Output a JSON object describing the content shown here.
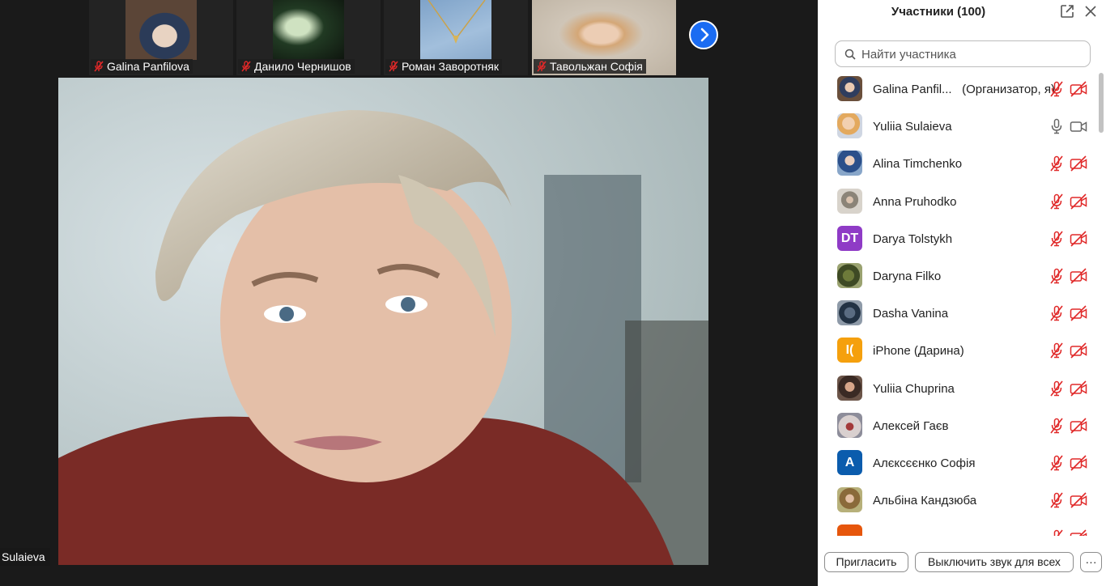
{
  "thumbnails": [
    {
      "name": "Galina Panfilova",
      "muted": true
    },
    {
      "name": "Данило Чернишов",
      "muted": true
    },
    {
      "name": "Роман Заворотняк",
      "muted": true
    },
    {
      "name": "Тавольжан Софія",
      "muted": true
    }
  ],
  "speaker": {
    "name_tag": "Sulaieva"
  },
  "panel": {
    "title": "Участники (100)",
    "search_placeholder": "Найти участника",
    "participants": [
      {
        "name": "Galina Panfil...",
        "role": "(Организатор, я)",
        "avatar": "photo",
        "mic": "muted",
        "cam": "off"
      },
      {
        "name": "Yuliia Sulaieva",
        "role": "",
        "avatar": "photo",
        "mic": "on",
        "cam": "on"
      },
      {
        "name": "Alina Timchenko",
        "role": "",
        "avatar": "photo",
        "mic": "muted",
        "cam": "off"
      },
      {
        "name": "Anna Pruhodko",
        "role": "",
        "avatar": "photo",
        "mic": "muted",
        "cam": "off"
      },
      {
        "name": "Darya Tolstykh",
        "role": "",
        "avatar": "initials",
        "initials": "DT",
        "avatar_color": "#8f3bc6",
        "mic": "muted",
        "cam": "off"
      },
      {
        "name": "Daryna Filko",
        "role": "",
        "avatar": "photo",
        "mic": "muted",
        "cam": "off"
      },
      {
        "name": "Dasha Vanina",
        "role": "",
        "avatar": "photo",
        "mic": "muted",
        "cam": "off"
      },
      {
        "name": "iPhone (Дарина)",
        "role": "",
        "avatar": "initials",
        "initials": "I(",
        "avatar_color": "#f5a00d",
        "mic": "muted",
        "cam": "off"
      },
      {
        "name": "Yuliia Chuprina",
        "role": "",
        "avatar": "photo",
        "mic": "muted",
        "cam": "off"
      },
      {
        "name": "Алексей Гаєв",
        "role": "",
        "avatar": "photo",
        "mic": "muted",
        "cam": "off"
      },
      {
        "name": "Алєксєєнко Софія",
        "role": "",
        "avatar": "initials",
        "initials": "A",
        "avatar_color": "#0b5cad",
        "mic": "muted",
        "cam": "off"
      },
      {
        "name": "Альбіна Кандзюба",
        "role": "",
        "avatar": "photo",
        "mic": "muted",
        "cam": "off"
      },
      {
        "name": "",
        "role": "",
        "avatar": "initials",
        "initials": "",
        "avatar_color": "#e6560c",
        "mic": "muted",
        "cam": "off"
      }
    ],
    "invite_label": "Пригласить",
    "mute_all_label": "Выключить звук для всех",
    "more_label": "···"
  },
  "colors": {
    "muted_red": "#e02828",
    "accent_blue": "#1b6cf2",
    "panel_bg": "#ffffff",
    "stage_bg": "#1a1a1a"
  }
}
